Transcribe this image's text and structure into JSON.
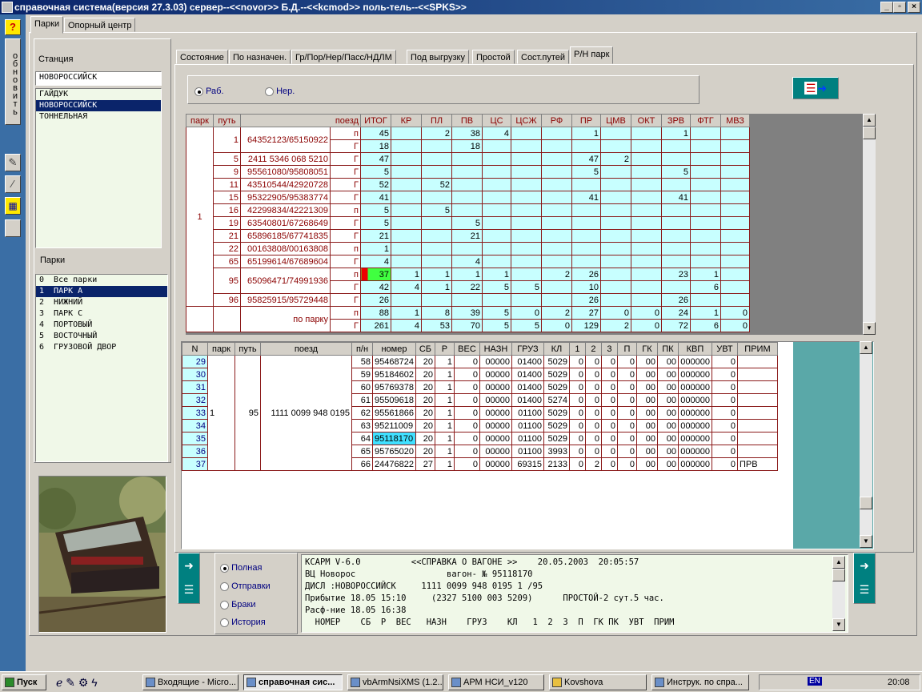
{
  "window": {
    "title": "справочная система(версия 27.3.03) сервер--<<novor>> Б.Д.--<<kcmod>> поль-тель--<<SPKS>>"
  },
  "left_toolbar": {
    "help_label": "?",
    "refresh_label": "обновить"
  },
  "top_tabs": [
    "Парки",
    "Опорный центр"
  ],
  "station": {
    "label": "Станция",
    "value": "НОВОРОССИЙСК",
    "list": [
      "ГАЙДУК",
      "НОВОРОССИЙСК",
      "ТОННЕЛЬНАЯ"
    ],
    "selected": 1
  },
  "parks": {
    "label": "Парки",
    "list": [
      "0  Все парки",
      "1  ПАРК А",
      "2  НИЖНИЙ",
      "3  ПАРК С",
      "4  ПОРТОВЫЙ",
      "5  ВОСТОЧНЫЙ",
      "6  ГРУЗОВОЙ ДВОР"
    ],
    "selected": 1
  },
  "main_tabs": [
    "Состояние",
    "По назначен.",
    "Гр/Пор/Нер/Пасс/НДЛМ",
    "Под выгрузку",
    "Простой",
    "Сост.путей",
    "Р/Н парк"
  ],
  "main_tab_active": 6,
  "filter": {
    "rab_label": "Раб.",
    "ner_label": "Нер.",
    "selected": "rab"
  },
  "top_table": {
    "headers": [
      "парк",
      "путь",
      "поезд",
      "",
      "ИТОГ",
      "КР",
      "ПЛ",
      "ПВ",
      "ЦС",
      "ЦСЖ",
      "РФ",
      "ПР",
      "ЦМВ",
      "ОКТ",
      "ЗРВ",
      "ФТГ",
      "МВЗ"
    ],
    "park": "1",
    "rows": [
      {
        "put": "1",
        "poezd": "64352123/65150922",
        "t": "п",
        "v": [
          "45",
          "",
          "2",
          "38",
          "4",
          "",
          "",
          "1",
          "",
          "",
          "1",
          "",
          ""
        ],
        "span": 2
      },
      {
        "t": "Г",
        "v": [
          "18",
          "",
          "",
          "18",
          "",
          "",
          "",
          "",
          "",
          "",
          "",
          "",
          ""
        ]
      },
      {
        "put": "5",
        "poezd": "2411 5346 068 5210",
        "t": "Г",
        "v": [
          "47",
          "",
          "",
          "",
          "",
          "",
          "",
          "47",
          "2",
          "",
          "",
          "",
          ""
        ]
      },
      {
        "put": "9",
        "poezd": "95561080/95808051",
        "t": "Г",
        "v": [
          "5",
          "",
          "",
          "",
          "",
          "",
          "",
          "5",
          "",
          "",
          "5",
          "",
          ""
        ]
      },
      {
        "put": "11",
        "poezd": "43510544/42920728",
        "t": "Г",
        "v": [
          "52",
          "",
          "52",
          "",
          "",
          "",
          "",
          "",
          "",
          "",
          "",
          "",
          ""
        ]
      },
      {
        "put": "15",
        "poezd": "95322905/95383774",
        "t": "Г",
        "v": [
          "41",
          "",
          "",
          "",
          "",
          "",
          "",
          "41",
          "",
          "",
          "41",
          "",
          ""
        ]
      },
      {
        "put": "16",
        "poezd": "42299834/42221309",
        "t": "п",
        "v": [
          "5",
          "",
          "5",
          "",
          "",
          "",
          "",
          "",
          "",
          "",
          "",
          "",
          ""
        ]
      },
      {
        "put": "19",
        "poezd": "63540801/67268649",
        "t": "Г",
        "v": [
          "5",
          "",
          "",
          "5",
          "",
          "",
          "",
          "",
          "",
          "",
          "",
          "",
          ""
        ]
      },
      {
        "put": "21",
        "poezd": "65896185/67741835",
        "t": "Г",
        "v": [
          "21",
          "",
          "",
          "21",
          "",
          "",
          "",
          "",
          "",
          "",
          "",
          "",
          ""
        ]
      },
      {
        "put": "22",
        "poezd": "00163808/00163808",
        "t": "п",
        "v": [
          "1",
          "",
          "",
          "",
          "",
          "",
          "",
          "",
          "",
          "",
          "",
          "",
          ""
        ]
      },
      {
        "put": "65",
        "poezd": "65199614/67689604",
        "t": "Г",
        "v": [
          "4",
          "",
          "",
          "4",
          "",
          "",
          "",
          "",
          "",
          "",
          "",
          "",
          ""
        ]
      },
      {
        "put": "95",
        "poezd": "65096471/74991936",
        "t": "п",
        "v": [
          "37",
          "1",
          "1",
          "1",
          "1",
          "",
          "2",
          "26",
          "",
          "",
          "23",
          "1",
          ""
        ],
        "span": 2,
        "mark": true
      },
      {
        "t": "Г",
        "v": [
          "42",
          "4",
          "1",
          "22",
          "5",
          "5",
          "",
          "10",
          "",
          "",
          "",
          "6",
          ""
        ]
      },
      {
        "put": "96",
        "poezd": "95825915/95729448",
        "t": "Г",
        "v": [
          "26",
          "",
          "",
          "",
          "",
          "",
          "",
          "26",
          "",
          "",
          "26",
          "",
          ""
        ]
      },
      {
        "put": "",
        "poezd": "по парку",
        "t": "п",
        "v": [
          "88",
          "1",
          "8",
          "39",
          "5",
          "0",
          "2",
          "27",
          "0",
          "0",
          "24",
          "1",
          "0"
        ],
        "span": 2
      },
      {
        "t": "Г",
        "v": [
          "261",
          "4",
          "53",
          "70",
          "5",
          "5",
          "0",
          "129",
          "2",
          "0",
          "72",
          "6",
          "0"
        ]
      }
    ]
  },
  "bottom_table": {
    "headers": [
      "N",
      "парк",
      "путь",
      "поезд",
      "п/н",
      "номер",
      "СБ",
      "Р",
      "ВЕС",
      "НАЗН",
      "ГРУЗ",
      "КЛ",
      "1",
      "2",
      "3",
      "П",
      "ГК",
      "ПК",
      "КВП",
      "УВТ",
      "ПРИМ"
    ],
    "park": "1",
    "put": "95",
    "poezd": "1111 0099 948 0195",
    "selected_row": 6,
    "rows": [
      [
        "29",
        "58",
        "95468724",
        "20",
        "1",
        "0",
        "00000",
        "01400",
        "5029",
        "0",
        "0",
        "0",
        "0",
        "00",
        "00",
        "000000",
        "0",
        ""
      ],
      [
        "30",
        "59",
        "95184602",
        "20",
        "1",
        "0",
        "00000",
        "01400",
        "5029",
        "0",
        "0",
        "0",
        "0",
        "00",
        "00",
        "000000",
        "0",
        ""
      ],
      [
        "31",
        "60",
        "95769378",
        "20",
        "1",
        "0",
        "00000",
        "01400",
        "5029",
        "0",
        "0",
        "0",
        "0",
        "00",
        "00",
        "000000",
        "0",
        ""
      ],
      [
        "32",
        "61",
        "95509618",
        "20",
        "1",
        "0",
        "00000",
        "01400",
        "5274",
        "0",
        "0",
        "0",
        "0",
        "00",
        "00",
        "000000",
        "0",
        ""
      ],
      [
        "33",
        "62",
        "95561866",
        "20",
        "1",
        "0",
        "00000",
        "01100",
        "5029",
        "0",
        "0",
        "0",
        "0",
        "00",
        "00",
        "000000",
        "0",
        ""
      ],
      [
        "34",
        "63",
        "95211009",
        "20",
        "1",
        "0",
        "00000",
        "01100",
        "5029",
        "0",
        "0",
        "0",
        "0",
        "00",
        "00",
        "000000",
        "0",
        ""
      ],
      [
        "35",
        "64",
        "95118170",
        "20",
        "1",
        "0",
        "00000",
        "01100",
        "5029",
        "0",
        "0",
        "0",
        "0",
        "00",
        "00",
        "000000",
        "0",
        ""
      ],
      [
        "36",
        "65",
        "95765020",
        "20",
        "1",
        "0",
        "00000",
        "01100",
        "3993",
        "0",
        "0",
        "0",
        "0",
        "00",
        "00",
        "000000",
        "0",
        ""
      ],
      [
        "37",
        "66",
        "24476822",
        "27",
        "1",
        "0",
        "00000",
        "69315",
        "2133",
        "0",
        "2",
        "0",
        "0",
        "00",
        "00",
        "000000",
        "0",
        "ПРВ"
      ]
    ]
  },
  "info_radios": {
    "options": [
      "Полная",
      "Отправки",
      "Браки",
      "История"
    ],
    "selected": 0
  },
  "info_text": {
    "lines": [
      "КСАРМ V-6.0          <<СПРАВКА О ВАГОНЕ >>    20.05.2003  20:05:57",
      "ВЦ Новорос                  вагон- № 95118170",
      "ДИСЛ :НОВОРОССИЙСК     1111 0099 948 0195 1 /95",
      "Прибытие 18.05 15:10     (2327 5100 003 5209)      ПРОСТОЙ-2 сут.5 час.",
      "Расф-ние 18.05 16:38",
      "  НОМЕР    СБ  Р  ВЕС   НАЗН    ГРУЗ    КЛ   1  2  3  П  ГК ПК  УВТ  ПРИМ"
    ]
  },
  "taskbar": {
    "start_label": "Пуск",
    "tasks": [
      "Входящие - Micro...",
      "справочная сис...",
      "vbArmNsiXMS (1.2...",
      "АРМ НСИ_v120",
      "Kovshova",
      "Инструк. по спра..."
    ],
    "active_task": 1,
    "lang": "EN",
    "clock": "20:08"
  },
  "colors": {
    "cyan_cell": "#c8ffff",
    "dark_red": "#8b0000",
    "selection": "#0a246a",
    "teal_panel": "#5aa8a8"
  }
}
